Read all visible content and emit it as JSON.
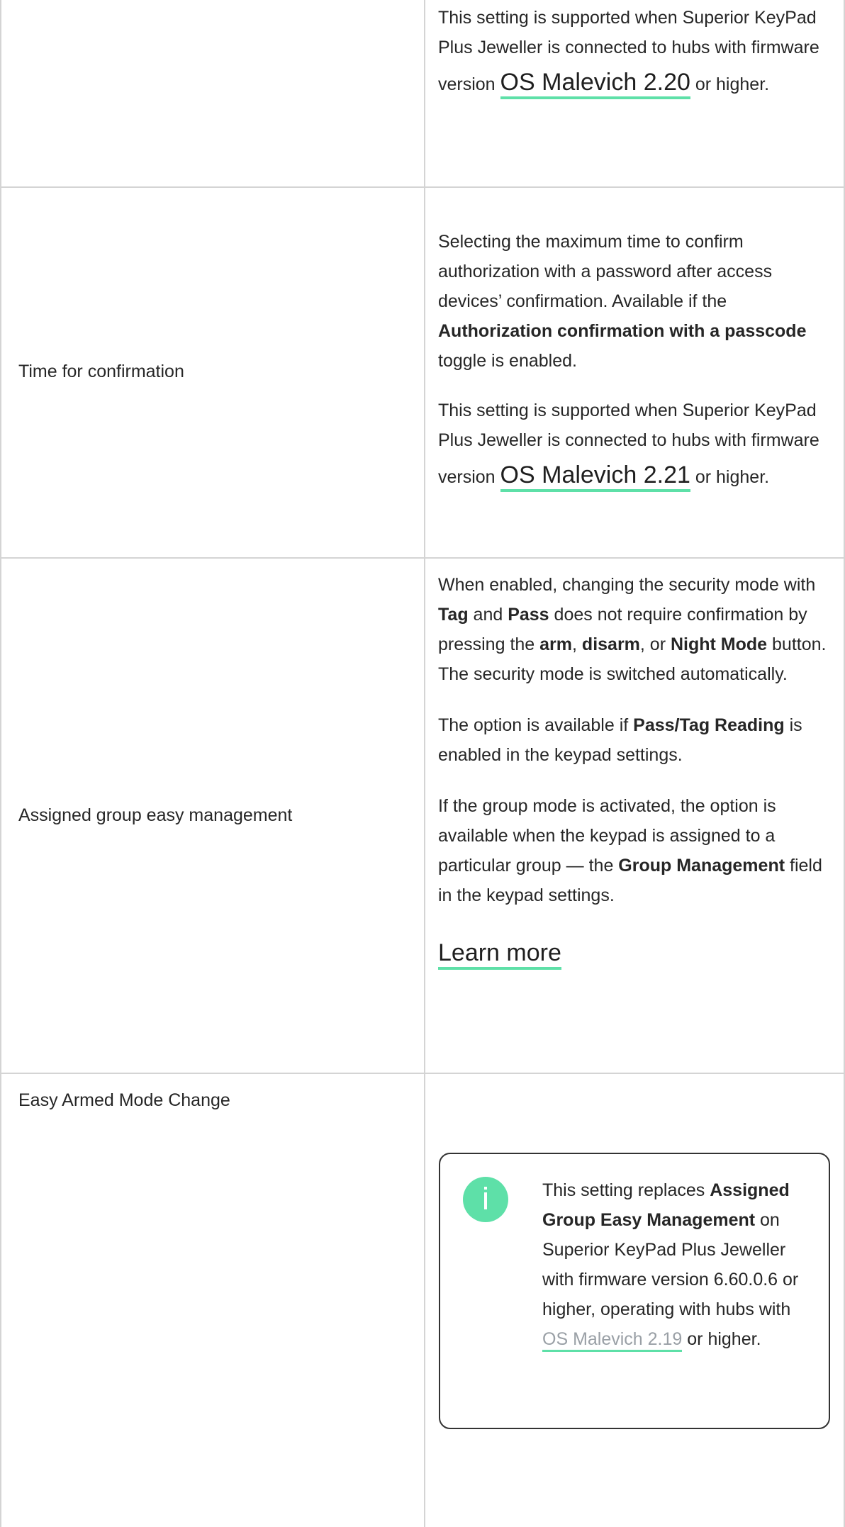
{
  "rows": [
    {
      "label": "",
      "top_note": {
        "pre": "This setting is supported when Superior KeyPad Plus Jeweller is connected to hubs with firmware version ",
        "link": "OS Malevich 2.20",
        "post": " or higher."
      }
    },
    {
      "label": "Time for confirmation",
      "desc": {
        "t1": "Selecting the maximum time to confirm authorization with a password after access devices’ confirmation. Available if the ",
        "b1": "Authorization confirmation with a passcode",
        "t2": " toggle is enabled."
      },
      "note": {
        "pre": "This setting is supported when Superior KeyPad Plus Jeweller is connected to hubs with firmware version ",
        "link": "OS Malevich 2.21",
        "post": " or higher."
      }
    },
    {
      "label": "Assigned group easy management",
      "p1": {
        "t1": "When enabled, changing the security mode with ",
        "b1": "Tag",
        "t2": " and ",
        "b2": "Pass",
        "t3": " does not require confirmation by pressing the ",
        "b3": "arm",
        "t4": ", ",
        "b4": "disarm",
        "t5": ", or ",
        "b5": "Night Mode",
        "t6": " button. The security mode is switched automatically."
      },
      "p2": {
        "t1": "The option is available if ",
        "b1": "Pass/Tag Reading",
        "t2": " is enabled in the keypad settings."
      },
      "p3": {
        "t1": "If the group mode is activated, the option is available when the keypad is assigned to a particular group — the ",
        "b1": "Group Management",
        "t2": " field in the keypad settings."
      },
      "learn_more": "Learn more"
    },
    {
      "label": "Easy Armed Mode Change",
      "callout": {
        "t1": "This setting replaces ",
        "b1": "Assigned Group Easy Management",
        "t2": " on Superior KeyPad Plus Jeweller with firmware version 6.60.0.6 or higher, operating with hubs with ",
        "link": "OS Malevich 2.19",
        "t3": " or higher."
      }
    }
  ],
  "colors": {
    "accent": "#5ee0a8",
    "border": "#d4d4d4",
    "text": "#262626"
  }
}
